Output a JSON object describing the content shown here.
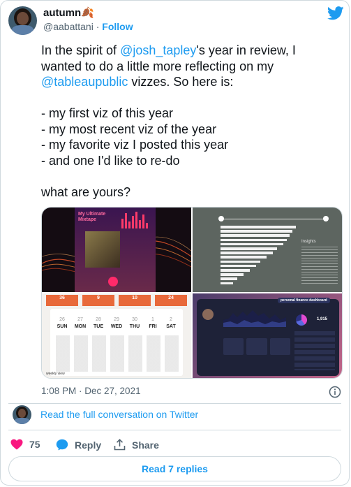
{
  "author": {
    "name": "autumn",
    "emoji": "🍂",
    "handle": "@aabattani",
    "separator": "·",
    "follow_label": "Follow",
    "avatar_icon": "profile-photo"
  },
  "tweet": {
    "lines": [
      [
        {
          "t": "In the spirit of ",
          "m": false
        },
        {
          "t": "@josh_tapley",
          "m": true
        },
        {
          "t": "'s year in review, I",
          "m": false
        }
      ],
      [
        {
          "t": "wanted to do a little more reflecting on my",
          "m": false
        }
      ],
      [
        {
          "t": "@tableaupublic",
          "m": true
        },
        {
          "t": " vizzes. So here is:",
          "m": false
        }
      ],
      [
        {
          "t": "",
          "m": false
        }
      ],
      [
        {
          "t": "- my first viz of this year",
          "m": false
        }
      ],
      [
        {
          "t": "- my most recent viz of the year",
          "m": false
        }
      ],
      [
        {
          "t": "- my favorite viz I posted this year",
          "m": false
        }
      ],
      [
        {
          "t": "- and one I'd like to re-do",
          "m": false
        }
      ],
      [
        {
          "t": "",
          "m": false
        }
      ],
      [
        {
          "t": "what are yours?",
          "m": false
        }
      ]
    ]
  },
  "media": {
    "image1": {
      "title": "My Ultimate Mixtape"
    },
    "image2": {
      "heading": "Insights"
    },
    "image3": {
      "stats": [
        "36",
        "9",
        "10",
        "24"
      ],
      "dates": [
        "26",
        "27",
        "28",
        "29",
        "30",
        "1",
        "2"
      ],
      "days": [
        "SUN",
        "MON",
        "TUE",
        "WED",
        "THU",
        "FRI",
        "SAT"
      ],
      "footer": "weekly view"
    },
    "image4": {
      "title": "personal finance dashboard",
      "kpi": "1,915"
    }
  },
  "timestamp": "1:08 PM · Dec 27, 2021",
  "conversation_link": "Read the full conversation on Twitter",
  "actions": {
    "like_count": "75",
    "reply_label": "Reply",
    "share_label": "Share"
  },
  "read_replies": "Read 7 replies",
  "colors": {
    "accent": "#1d9bf0",
    "like": "#f91880",
    "text": "#0f1419",
    "muted": "#536471",
    "border": "#cfd9de"
  }
}
